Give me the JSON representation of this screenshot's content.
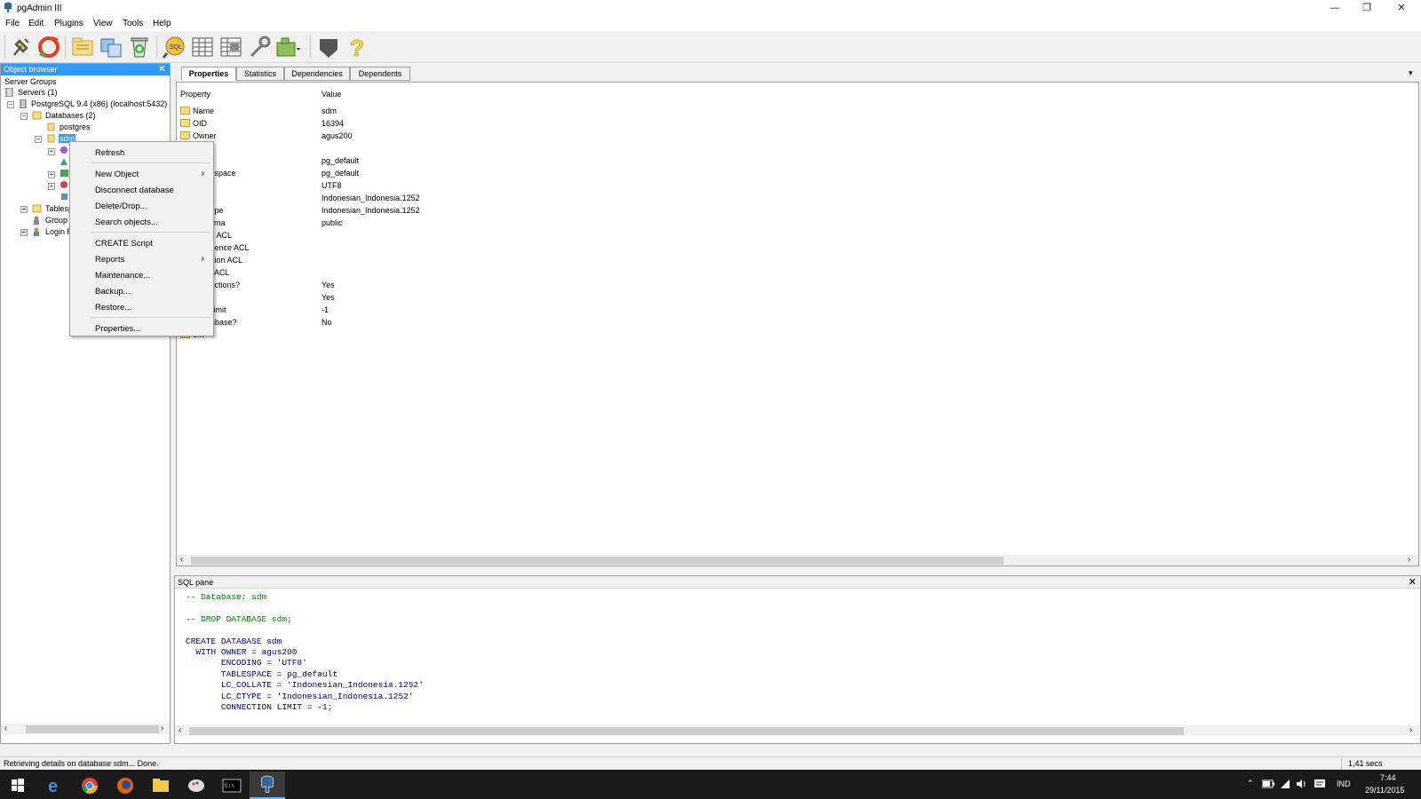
{
  "window": {
    "title": "pgAdmin III"
  },
  "menu": [
    "File",
    "Edit",
    "Plugins",
    "View",
    "Tools",
    "Help"
  ],
  "toolbar": {
    "buttons": [
      "connect-icon",
      "refresh-icon",
      "properties-icon",
      "create-icon",
      "drop-icon",
      "sql-query-icon",
      "view-data-icon",
      "view-filtered-data-icon",
      "maintenance-icon",
      "plugins-icon",
      "hint-icon",
      "help-icon"
    ]
  },
  "object_browser": {
    "title": "Object browser",
    "tree": {
      "server_groups": "Server Groups",
      "servers": "Servers (1)",
      "server": "PostgreSQL 9.4 (x86) (localhost:5432)",
      "databases": "Databases (2)",
      "db_postgres": "postgres",
      "db_sdm": "sdm",
      "tablespaces": "Tablesp",
      "group_roles": "Group",
      "login_roles": "Login R"
    }
  },
  "context_menu": {
    "items": [
      {
        "label": "Refresh"
      },
      {
        "label": "New Object",
        "submenu": true
      },
      {
        "label": "Disconnect database"
      },
      {
        "label": "Delete/Drop..."
      },
      {
        "label": "Search objects..."
      },
      {
        "label": "CREATE Script"
      },
      {
        "label": "Reports",
        "submenu": true
      },
      {
        "label": "Maintenance..."
      },
      {
        "label": "Backup..."
      },
      {
        "label": "Restore..."
      },
      {
        "label": "Properties..."
      }
    ]
  },
  "properties": {
    "tabs": [
      "Properties",
      "Statistics",
      "Dependencies",
      "Dependents"
    ],
    "active_tab": "Properties",
    "columns": [
      "Property",
      "Value"
    ],
    "rows": [
      {
        "property": "Name",
        "value": "sdm"
      },
      {
        "property": "OID",
        "value": "16394"
      },
      {
        "property": "Owner",
        "value": "agus200"
      },
      {
        "property": "",
        "value": ""
      },
      {
        "property": "space",
        "value": "pg_default"
      },
      {
        "property": "t tablespace",
        "value": "pg_default"
      },
      {
        "property": "ng",
        "value": "UTF8"
      },
      {
        "property": "on",
        "value": "Indonesian_Indonesia.1252"
      },
      {
        "property": "cter type",
        "value": "Indonesian_Indonesia.1252"
      },
      {
        "property": "t schema",
        "value": "public"
      },
      {
        "property": "t table ACL",
        "value": ""
      },
      {
        "property": "t sequence ACL",
        "value": ""
      },
      {
        "property": "t function ACL",
        "value": ""
      },
      {
        "property": "t type ACL",
        "value": ""
      },
      {
        "property": "connections?",
        "value": "Yes"
      },
      {
        "property": "cted?",
        "value": "Yes"
      },
      {
        "property": "ction limit",
        "value": "-1"
      },
      {
        "property": "n database?",
        "value": "No"
      },
      {
        "property": "ent",
        "value": ""
      }
    ]
  },
  "sql_pane": {
    "title": "SQL pane",
    "lines": [
      {
        "text": "-- Database: sdm",
        "kind": "comment"
      },
      {
        "text": "",
        "kind": "code"
      },
      {
        "text": "-- DROP DATABASE sdm;",
        "kind": "comment"
      },
      {
        "text": "",
        "kind": "code"
      },
      {
        "text": "CREATE DATABASE sdm",
        "kind": "code"
      },
      {
        "text": "  WITH OWNER = agus200",
        "kind": "code"
      },
      {
        "text": "       ENCODING = 'UTF8'",
        "kind": "code"
      },
      {
        "text": "       TABLESPACE = pg_default",
        "kind": "code"
      },
      {
        "text": "       LC_COLLATE = 'Indonesian_Indonesia.1252'",
        "kind": "code"
      },
      {
        "text": "       LC_CTYPE = 'Indonesian_Indonesia.1252'",
        "kind": "code"
      },
      {
        "text": "       CONNECTION LIMIT = -1;",
        "kind": "code"
      }
    ]
  },
  "status": {
    "message": "Retrieving details on database sdm... Done.",
    "elapsed": "1,41 secs"
  },
  "taskbar": {
    "apps": [
      "windows-start-icon",
      "edge-icon",
      "chrome-icon",
      "firefox-icon",
      "file-explorer-icon",
      "paint-icon",
      "cmd-icon",
      "pgadmin-icon"
    ],
    "active_app": "pgadmin-icon",
    "language": "IND",
    "time": "7:44",
    "date": "29/11/2015"
  },
  "colors": {
    "selection": "#3399ff",
    "sql_comment": "#007f00",
    "sql_keyword": "#000080",
    "sql_string": "#7f007f",
    "taskbar": "#1a1a1a"
  }
}
